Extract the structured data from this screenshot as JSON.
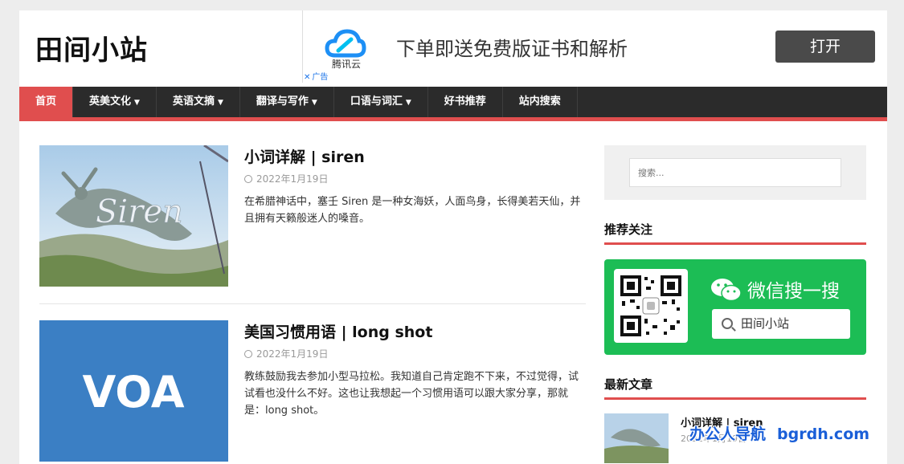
{
  "site": {
    "title": "田间小站"
  },
  "ad": {
    "brand": "腾讯云",
    "text": "下单即送免费版证书和解析",
    "button": "打开",
    "badge": "广告",
    "badge_close": "✕",
    "brand_color": "#1d8ff5"
  },
  "nav": {
    "items": [
      {
        "label": "首页",
        "has_dropdown": false,
        "active": true
      },
      {
        "label": "英美文化",
        "has_dropdown": true
      },
      {
        "label": "英语文摘",
        "has_dropdown": true
      },
      {
        "label": "翻译与写作",
        "has_dropdown": true
      },
      {
        "label": "口语与词汇",
        "has_dropdown": true
      },
      {
        "label": "好书推荐",
        "has_dropdown": false
      },
      {
        "label": "站内搜索",
        "has_dropdown": false
      }
    ],
    "accent": "#e04e4e"
  },
  "posts": [
    {
      "title": "小词详解 | siren",
      "date": "2022年1月19日",
      "excerpt": "在希腊神话中，塞壬 Siren 是一种女海妖，人面鸟身，长得美若天仙，并且拥有天籁般迷人的嗓音。",
      "image_caption": "Siren"
    },
    {
      "title": "美国习惯用语 | long shot",
      "date": "2022年1月19日",
      "excerpt": "教练鼓励我去参加小型马拉松。我知道自己肯定跑不下来，不过觉得，试试看也没什么不好。这也让我想起一个习惯用语可以跟大家分享，那就是：long shot。",
      "image_caption": "VOA"
    }
  ],
  "sidebar": {
    "search_placeholder": "搜索...",
    "recommend_title": "推荐关注",
    "wechat": {
      "title": "微信搜一搜",
      "search_text": "田间小站",
      "bg": "#1cbd55"
    },
    "recent_title": "最新文章",
    "recent": [
      {
        "title": "小词详解 | siren",
        "date": "2022年1月19日"
      }
    ]
  },
  "watermark": {
    "cn": "办公人导航",
    "en": "bgrdh.com"
  }
}
